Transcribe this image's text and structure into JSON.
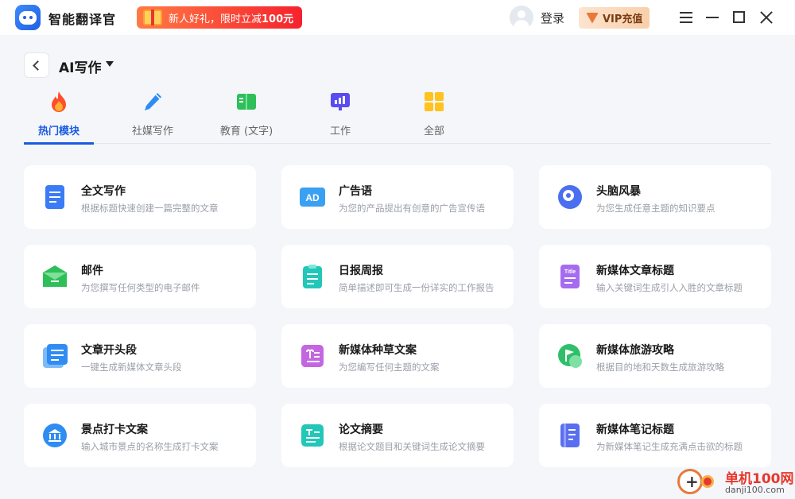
{
  "titlebar": {
    "app_name": "智能翻译官",
    "promo_text_prefix": "新人好礼，限时立减",
    "promo_amount": "100元",
    "login_label": "登录",
    "vip_label": "VIP充值"
  },
  "header": {
    "title": "AI写作"
  },
  "tabs": [
    {
      "label": "热门模块",
      "icon": "fire-icon",
      "active": true
    },
    {
      "label": "社媒写作",
      "icon": "pen-icon",
      "active": false
    },
    {
      "label": "教育 (文字)",
      "icon": "book-icon",
      "active": false
    },
    {
      "label": "工作",
      "icon": "presentation-icon",
      "active": false
    },
    {
      "label": "全部",
      "icon": "grid-icon",
      "active": false
    }
  ],
  "cards": [
    {
      "title": "全文写作",
      "desc": "根据标题快速创建一篇完整的文章",
      "icon": "document-icon",
      "color": "#3b7bf6"
    },
    {
      "title": "广告语",
      "desc": "为您的产品提出有创意的广告宣传语",
      "icon": "ad-icon",
      "color": "#3aa0f2"
    },
    {
      "title": "头脑风暴",
      "desc": "为您生成任意主题的知识要点",
      "icon": "brain-icon",
      "color": "#4a6ff0"
    },
    {
      "title": "邮件",
      "desc": "为您撰写任何类型的电子邮件",
      "icon": "mail-icon",
      "color": "#2fbf5a"
    },
    {
      "title": "日报周报",
      "desc": "简单描述即可生成一份详实的工作报告",
      "icon": "clipboard-icon",
      "color": "#22c7b8"
    },
    {
      "title": "新媒体文章标题",
      "desc": "输入关键词生成引人入胜的文章标题",
      "icon": "title-icon",
      "color": "#a66cf0"
    },
    {
      "title": "文章开头段",
      "desc": "一键生成新媒体文章头段",
      "icon": "paragraph-icon",
      "color": "#2f8cf3"
    },
    {
      "title": "新媒体种草文案",
      "desc": "为您编写任何主题的文案",
      "icon": "sprout-icon",
      "color": "#c466e0"
    },
    {
      "title": "新媒体旅游攻略",
      "desc": "根据目的地和天数生成旅游攻略",
      "icon": "flag-icon",
      "color": "#2fbf6a"
    },
    {
      "title": "景点打卡文案",
      "desc": "输入城市景点的名称生成打卡文案",
      "icon": "landmark-icon",
      "color": "#2f8cf3"
    },
    {
      "title": "论文摘要",
      "desc": "根据论文题目和关键词生成论文摘要",
      "icon": "abstract-icon",
      "color": "#22c7b8"
    },
    {
      "title": "新媒体笔记标题",
      "desc": "为新媒体笔记生成充满点击欲的标题",
      "icon": "notebook-icon",
      "color": "#5a6ff0"
    }
  ],
  "watermark": {
    "title": "单机100网",
    "url": "danji100.com"
  }
}
